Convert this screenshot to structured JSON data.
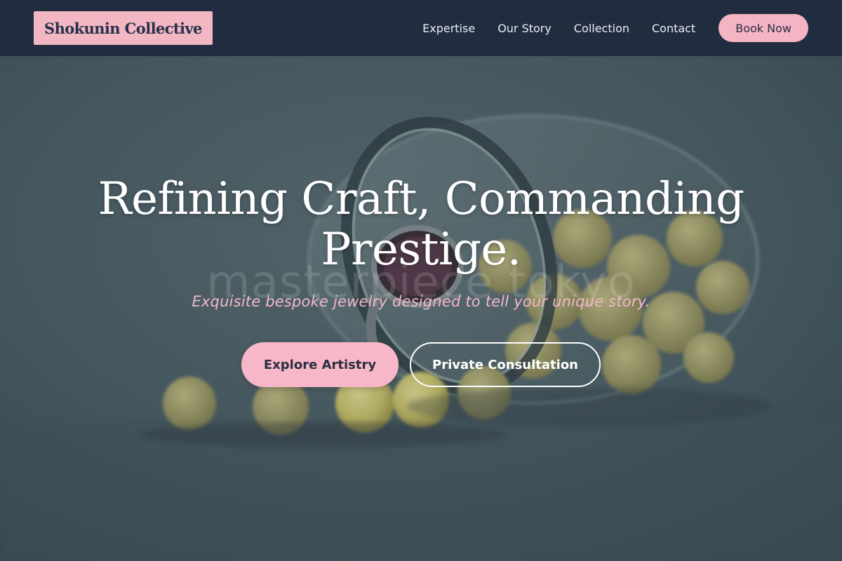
{
  "header": {
    "brand": "Shokunin Collective",
    "nav": [
      {
        "label": "Expertise"
      },
      {
        "label": "Our Story"
      },
      {
        "label": "Collection"
      },
      {
        "label": "Contact"
      }
    ],
    "cta_label": "Book Now"
  },
  "hero": {
    "background_image": "jar-of-candies-with-ring-photo",
    "watermark": "masterpiece tokyo",
    "headline_line1": "Refining Craft, Commanding",
    "headline_line2": "Prestige.",
    "subheadline": "Exquisite bespoke jewelry designed to tell your unique story.",
    "primary_button": "Explore Artistry",
    "secondary_button": "Private Consultation"
  },
  "colors": {
    "header_bg": "#212d3f",
    "accent_pink": "#f4b4c4",
    "hero_bg": "#4e6168",
    "white": "#ffffff"
  }
}
